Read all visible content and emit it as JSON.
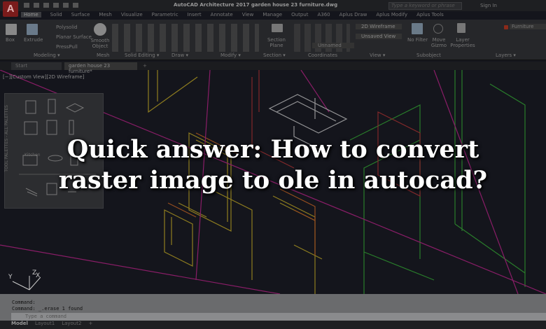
{
  "app": {
    "title": "AutoCAD Architecture 2017   garden house 23 furniture.dwg",
    "logo": "A",
    "search_placeholder": "Type a keyword or phrase",
    "sign_in": "Sign In"
  },
  "ribbon_tabs": [
    "Home",
    "Solid",
    "Surface",
    "Mesh",
    "Visualize",
    "Parametric",
    "Insert",
    "Annotate",
    "View",
    "Manage",
    "Output",
    "A360",
    "Aplus Draw",
    "Aplus Modify",
    "Aplus Tools"
  ],
  "ribbon": {
    "buttons": {
      "box": "Box",
      "extrude": "Extrude",
      "polysolid": "Polysolid",
      "planar_surface": "Planar Surface",
      "presspull": "PressPull",
      "smooth_object": "Smooth Object",
      "section_plane": "Section Plane",
      "no_filter": "No Filter",
      "move_gizmo": "Move Gizmo",
      "layer_properties": "Layer Properties"
    },
    "dropdowns": {
      "visual_style": "2D Wireframe",
      "view": "Unsaved View",
      "ucs": "Unnamed",
      "layer": "Furniture"
    },
    "panels": [
      "Modeling ▾",
      "Mesh",
      "Solid Editing ▾",
      "Draw ▾",
      "Modify ▾",
      "Section ▾",
      "Coordinates",
      "View ▾",
      "Subobject",
      "Layers ▾"
    ]
  },
  "doc_tabs": [
    "Start",
    "garden house 23 furniture*",
    "+"
  ],
  "viewport_label": "[−][Custom View][2D Wireframe]",
  "palette": {
    "section_label": "Kitchen",
    "side_title": "TOOL PALETTES - ALL PALETTES"
  },
  "ucs": {
    "x": "X",
    "y": "Y",
    "z": "Z"
  },
  "command": {
    "history": [
      "Command:",
      "Command:  _.erase 1 found"
    ],
    "placeholder": "Type a command"
  },
  "layout_tabs": [
    "Model",
    "Layout1",
    "Layout2",
    "+"
  ],
  "headline": {
    "line1": "Quick answer: How to convert",
    "line2": "raster image to ole in autocad?"
  }
}
